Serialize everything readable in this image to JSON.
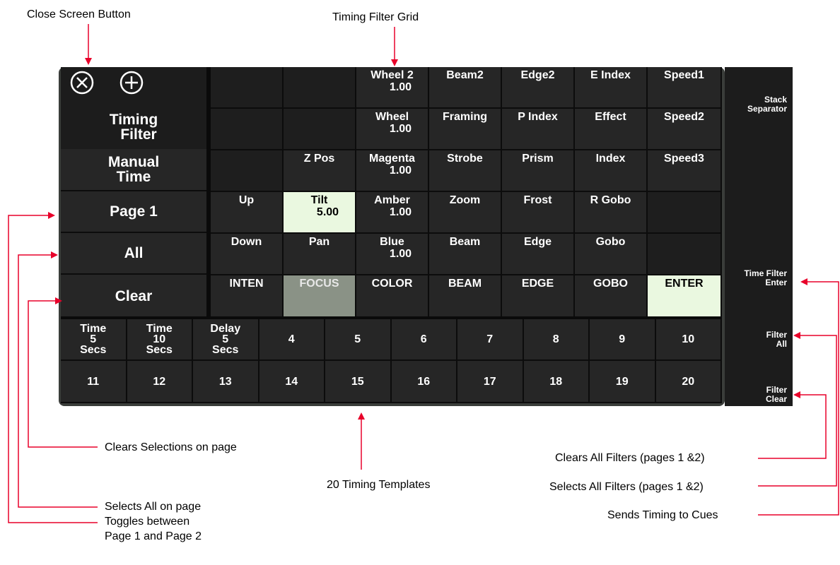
{
  "callouts": {
    "close_screen_button": "Close Screen Button",
    "timing_filter_grid": "Timing Filter Grid",
    "clears_selections": "Clears Selections on page",
    "selects_all": "Selects All on page",
    "toggles_line1": "Toggles between",
    "toggles_line2": "Page 1 and Page 2",
    "timing_templates": "20 Timing Templates",
    "clears_all_filters": "Clears All Filters (pages 1 &2)",
    "selects_all_filters": "Selects All Filters (pages 1 &2)",
    "sends_timing": "Sends Timing to Cues"
  },
  "left_panel": {
    "title_line1": "Timing",
    "title_line2": "Filter",
    "manual_line1": "Manual",
    "manual_line2": "Time",
    "page": "Page 1",
    "all": "All",
    "clear": "Clear"
  },
  "grid": [
    [
      {
        "label": ""
      },
      {
        "label": ""
      },
      {
        "label": "Wheel 2",
        "value": "1.00"
      },
      {
        "label": "Beam2"
      },
      {
        "label": "Edge2"
      },
      {
        "label": "E Index"
      },
      {
        "label": "Speed1"
      }
    ],
    [
      {
        "label": ""
      },
      {
        "label": ""
      },
      {
        "label": "Wheel",
        "value": "1.00"
      },
      {
        "label": "Framing"
      },
      {
        "label": "P Index"
      },
      {
        "label": "Effect"
      },
      {
        "label": "Speed2"
      }
    ],
    [
      {
        "label": ""
      },
      {
        "label": "Z Pos"
      },
      {
        "label": "Magenta",
        "value": "1.00"
      },
      {
        "label": "Strobe"
      },
      {
        "label": "Prism"
      },
      {
        "label": "Index"
      },
      {
        "label": "Speed3"
      }
    ],
    [
      {
        "label": "Up"
      },
      {
        "label": "Tilt",
        "value": "5.00",
        "state": "selected"
      },
      {
        "label": "Amber",
        "value": "1.00"
      },
      {
        "label": "Zoom"
      },
      {
        "label": "Frost"
      },
      {
        "label": "R Gobo"
      },
      {
        "label": ""
      }
    ],
    [
      {
        "label": "Down"
      },
      {
        "label": "Pan"
      },
      {
        "label": "Blue",
        "value": "1.00"
      },
      {
        "label": "Beam"
      },
      {
        "label": "Edge"
      },
      {
        "label": "Gobo"
      },
      {
        "label": ""
      }
    ],
    [
      {
        "label": "INTEN"
      },
      {
        "label": "FOCUS",
        "state": "active"
      },
      {
        "label": "COLOR"
      },
      {
        "label": "BEAM"
      },
      {
        "label": "EDGE"
      },
      {
        "label": "GOBO"
      },
      {
        "label": "ENTER",
        "state": "selected"
      }
    ]
  ],
  "templates": [
    [
      "Time",
      "5",
      "Secs"
    ],
    [
      "Time",
      "10",
      "Secs"
    ],
    [
      "Delay",
      "5",
      "Secs"
    ],
    [
      "4"
    ],
    [
      "5"
    ],
    [
      "6"
    ],
    [
      "7"
    ],
    [
      "8"
    ],
    [
      "9"
    ],
    [
      "10"
    ],
    [
      "11"
    ],
    [
      "12"
    ],
    [
      "13"
    ],
    [
      "14"
    ],
    [
      "15"
    ],
    [
      "16"
    ],
    [
      "17"
    ],
    [
      "18"
    ],
    [
      "19"
    ],
    [
      "20"
    ]
  ],
  "right_side": {
    "stack_line1": "Stack",
    "stack_line2": "Separator",
    "time_filter_line1": "Time Filter",
    "time_filter_line2": "Enter",
    "filter_all_line1": "Filter",
    "filter_all_line2": "All",
    "filter_clear_line1": "Filter",
    "filter_clear_line2": "Clear"
  },
  "icons": {
    "close": "close-circle-icon",
    "add": "add-circle-icon"
  },
  "colors": {
    "selected_cell": "#eaf8e0",
    "active_cell": "#8a9286",
    "panel_bg": "#1c1c1c",
    "callout_arrow": "#e8002a"
  }
}
